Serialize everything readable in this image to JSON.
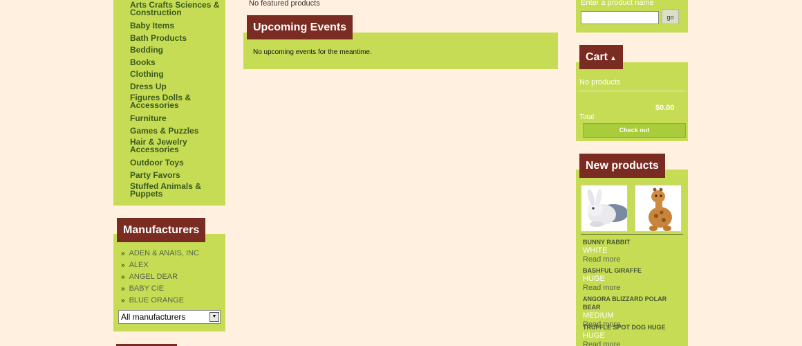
{
  "categories": {
    "items": [
      {
        "label": "Arts Crafts Sciences & Construction",
        "lines": 2
      },
      {
        "label": "Baby Items",
        "lines": 1
      },
      {
        "label": "Bath Products",
        "lines": 1
      },
      {
        "label": "Bedding",
        "lines": 1
      },
      {
        "label": "Books",
        "lines": 1
      },
      {
        "label": "Clothing",
        "lines": 1
      },
      {
        "label": "Dress Up",
        "lines": 1
      },
      {
        "label": "Figures Dolls & Accessories",
        "lines": 2
      },
      {
        "label": "Furniture",
        "lines": 1
      },
      {
        "label": "Games & Puzzles",
        "lines": 1
      },
      {
        "label": "Hair & Jewelry Accessories",
        "lines": 2
      },
      {
        "label": "Outdoor Toys",
        "lines": 1
      },
      {
        "label": "Party Favors",
        "lines": 1
      },
      {
        "label": "Stuffed Animals & Puppets",
        "lines": 2
      }
    ]
  },
  "manufacturers": {
    "title": "Manufacturers",
    "items": [
      "ADEN & ANAIS, INC",
      "ALEX",
      "ANGEL DEAR",
      "BABY CIE",
      "BLUE ORANGE"
    ],
    "select_value": "All manufacturers"
  },
  "featured": {
    "empty_text": "No featured products"
  },
  "events": {
    "title": "Upcoming Events",
    "empty_text": "No upcoming events for the meantime."
  },
  "search": {
    "label": "Enter a product name",
    "value": "",
    "go_label": "go"
  },
  "cart": {
    "title": "Cart",
    "empty_text": "No products",
    "total_value": "$0.00",
    "total_label": "Total",
    "checkout_label": "Check out"
  },
  "new_products": {
    "title": "New products",
    "thumbnails": [
      {
        "icon": "bunny-rabbit-image"
      },
      {
        "icon": "giraffe-image"
      }
    ],
    "items": [
      {
        "name": "BUNNY RABBIT",
        "desc": "WHITE",
        "more": "Read more"
      },
      {
        "name": "BASHFUL GIRAFFE",
        "desc": "HUGE",
        "more": "Read more"
      },
      {
        "name": "ANGORA BLIZZARD POLAR BEAR",
        "desc": "MEDIUM",
        "more": "Read more"
      },
      {
        "name": "TRUFFLE SPOT DOG HUGE",
        "desc": "HUGE",
        "more": "Read more"
      }
    ]
  },
  "colors": {
    "page_bg": "#fff0e0",
    "block_green": "#c6dc55",
    "title_brown": "#7a2c22"
  }
}
